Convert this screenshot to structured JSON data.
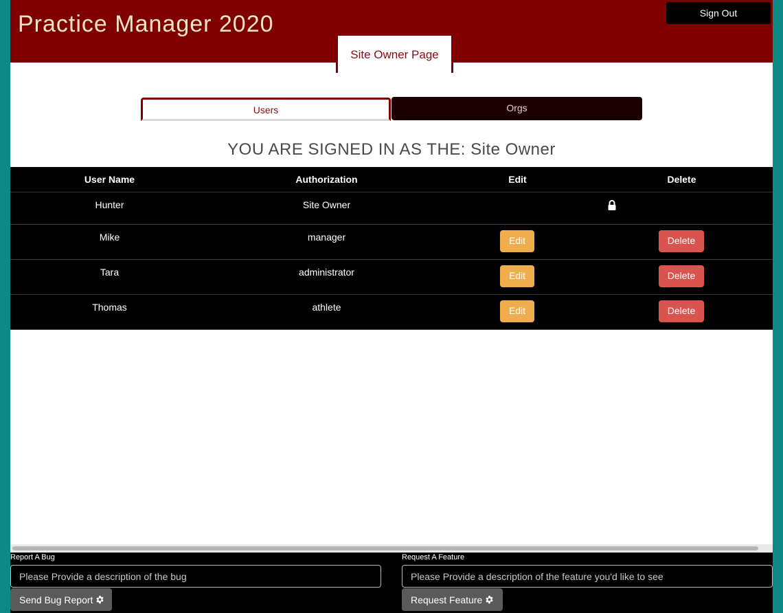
{
  "header": {
    "app_title": "Practice Manager 2020",
    "sign_out_label": "Sign Out",
    "page_tab_label": "Site Owner Page"
  },
  "tabs": {
    "users_label": "Users",
    "orgs_label": "Orgs"
  },
  "status": {
    "signed_in_text": "YOU ARE SIGNED IN AS THE: Site Owner"
  },
  "table": {
    "columns": [
      "User Name",
      "Authorization",
      "Edit",
      "Delete"
    ],
    "rows": [
      {
        "name": "Hunter",
        "auth": "Site Owner",
        "locked": true
      },
      {
        "name": "Mike",
        "auth": "manager",
        "edit": "Edit",
        "delete": "Delete"
      },
      {
        "name": "Tara",
        "auth": "administrator",
        "edit": "Edit",
        "delete": "Delete"
      },
      {
        "name": "Thomas",
        "auth": "athlete",
        "edit": "Edit",
        "delete": "Delete"
      }
    ]
  },
  "footer": {
    "bug_label": "Report A Bug",
    "bug_placeholder": "Please Provide a description of the bug",
    "bug_button": "Send Bug Report",
    "feature_label": "Request A Feature",
    "feature_placeholder": "Please Provide a description of the feature you'd like to see",
    "feature_button": "Request Feature "
  },
  "icons": {
    "lock": "lock-icon",
    "gear": "gear-icon"
  },
  "colors": {
    "brand": "#7f0000",
    "edit": "#f0ad4e",
    "delete": "#d9534f",
    "background": "#0d8a86"
  }
}
